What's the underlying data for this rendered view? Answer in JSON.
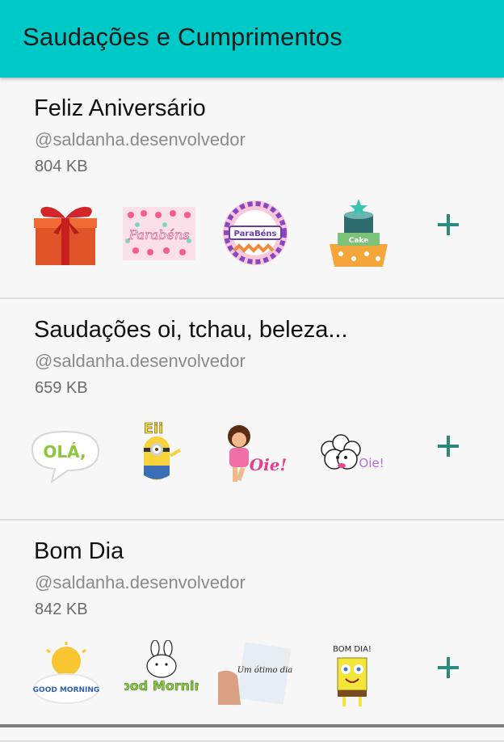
{
  "app_bar": {
    "title": "Saudações e Cumprimentos"
  },
  "packs": [
    {
      "name": "Feliz Aniversário",
      "author": "@saldanha.desenvolvedor",
      "size": "804 KB",
      "stickers": [
        "gift-sticker",
        "hearts-card-sticker",
        "parabens-balloon-sticker",
        "cake-sticker"
      ],
      "sticker_texts": [
        "",
        "",
        "ParaBéns",
        "Cake"
      ],
      "add_label": "+"
    },
    {
      "name": "Saudações oi, tchau, beleza...",
      "author": "@saldanha.desenvolvedor",
      "size": "659 KB",
      "stickers": [
        "ola-bubble-sticker",
        "minion-sticker",
        "girl-oie-sticker",
        "sheep-oie-sticker"
      ],
      "sticker_texts": [
        "OLÁ,",
        "Eii",
        "Oie!",
        "Oie!"
      ],
      "add_label": "+"
    },
    {
      "name": "Bom Dia",
      "author": "@saldanha.desenvolvedor",
      "size": "842 KB",
      "stickers": [
        "sun-good-morning-sticker",
        "bunny-good-morning-sticker",
        "hand-card-sticker",
        "sponge-bom-dia-sticker"
      ],
      "sticker_texts": [
        "GOOD MORNING",
        "Good Morning",
        "Um ótimo dia",
        "BOM DIA!"
      ],
      "add_label": "+"
    }
  ],
  "colors": {
    "app_bar": "#00c9c8",
    "accent_plus": "#2d8a7a"
  }
}
